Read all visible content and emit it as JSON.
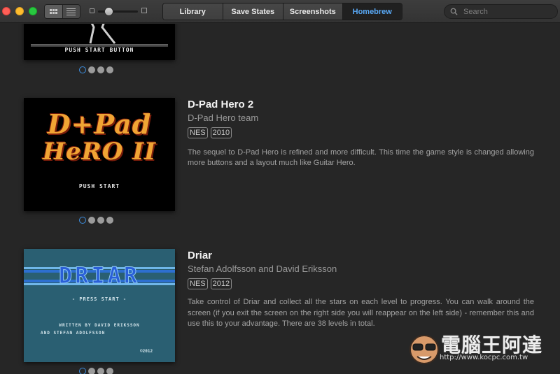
{
  "window": {
    "traffic_lights": [
      "close",
      "minimize",
      "zoom"
    ],
    "view_modes": [
      "grid-view",
      "list-view"
    ]
  },
  "tabs": [
    {
      "label": "Library",
      "active": false
    },
    {
      "label": "Save States",
      "active": false
    },
    {
      "label": "Screenshots",
      "active": false
    },
    {
      "label": "Homebrew",
      "active": true
    }
  ],
  "colors": {
    "accent": "#58a8f5",
    "background": "#262626",
    "active_dot": "#3d8fe0"
  },
  "search": {
    "placeholder": "Search",
    "value": ""
  },
  "entries": [
    {
      "partial": true,
      "screenshot_text": "PUSH START BUTTON",
      "dot_count": 4,
      "active_dot": 0
    },
    {
      "title": "D-Pad Hero 2",
      "author": "D-Pad Hero team",
      "system": "NES",
      "year": "2010",
      "description": "The sequel to D-Pad Hero is refined and more difficult. This time the game style is changed allowing more buttons and a layout much like Guitar Hero.",
      "logo_line1": "D+Pad",
      "logo_line2": "HeRO II",
      "screenshot_text": "PUSH START",
      "dot_count": 4,
      "active_dot": 0
    },
    {
      "title": "Driar",
      "author": "Stefan Adolfsson and David Eriksson",
      "system": "NES",
      "year": "2012",
      "description": "Take control of Driar and collect all the stars on each level to progress. You can walk around the screen (if you exit the screen on the right side you will reappear on the left side) - remember this and use this to your advantage. There are 38 levels in total.",
      "logo": "DRIAR",
      "press_start": "- PRESS START -",
      "credits_line1": "WRITTEN BY DAVID ERIKSSON",
      "credits_line2": "AND STEFAN ADOLFSSON",
      "copyright": "©2012",
      "dot_count": 4,
      "active_dot": 0
    }
  ],
  "watermark": {
    "text": "電腦王阿達",
    "url": "http://www.kocpc.com.tw"
  }
}
